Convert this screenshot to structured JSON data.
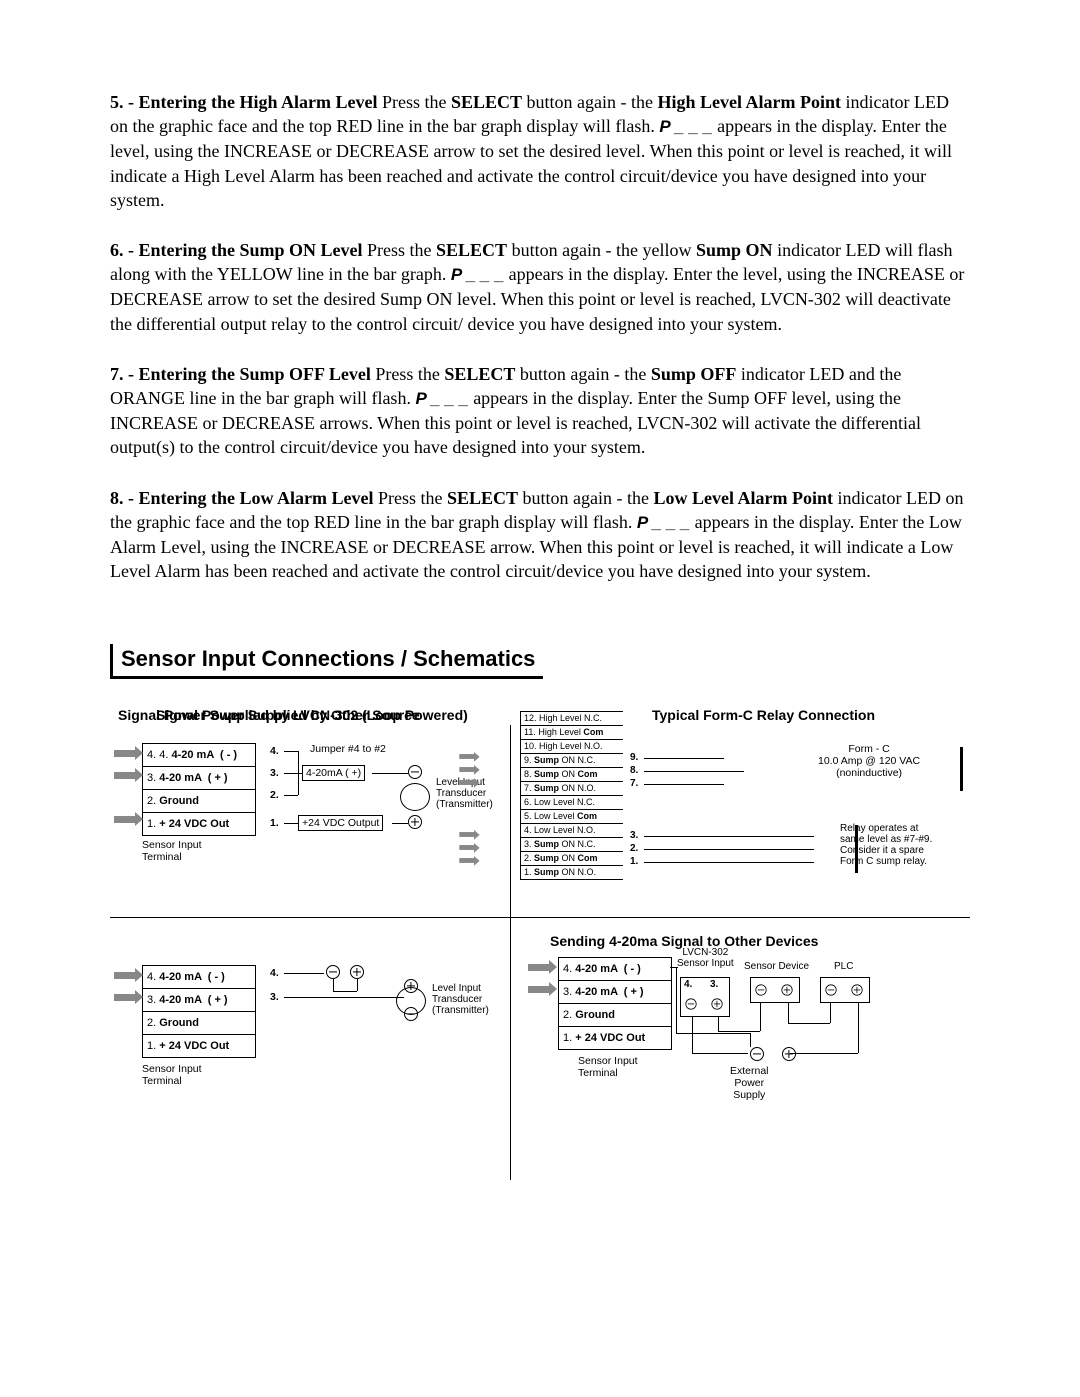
{
  "para5": {
    "lead": "5. - Entering the High Alarm Level",
    "body_a": "   Press the ",
    "select": "SELECT",
    "body_b": " button again - the ",
    "hl": "High Level Alarm Point",
    "body_c": " indicator LED on the graphic face and the top RED line in the bar graph display will flash.  ",
    "pcode": "P _ _ _",
    "body_d": " appears in the display.  Enter the level, using the INCREASE or DECREASE arrow to set the desired level.  When this point or level is reached, it will indicate a High Level Alarm has been reached and activate the control circuit/device you have designed into your system."
  },
  "para6": {
    "lead": "6. - Entering the Sump ON Level",
    "body_a": "   Press the ",
    "select": "SELECT",
    "body_b": " button again -  the yellow ",
    "hl": "Sump ON",
    "body_c": " indicator LED will flash along with the YELLOW  line in the bar graph.  ",
    "pcode": "P _ _ _",
    "body_d": "  appears in the display.  Enter the level, using the INCREASE or DECREASE arrow to set the desired Sump ON level.  When this point or level is reached, LVCN-302 will deactivate the differential output relay to the control circuit/ device you have designed into your system."
  },
  "para7": {
    "lead": "7. - Entering the Sump OFF Level",
    "body_a": "   Press the ",
    "select": "SELECT",
    "body_b": " button again - the ",
    "hl": "Sump OFF",
    "body_c": "  indicator LED and the ORANGE line in the bar graph will flash.  ",
    "pcode": "P _ _ _",
    "body_d": "  appears in the display.   Enter the Sump OFF level, using the INCREASE or DECREASE arrows.  When this point or level is reached, LVCN-302 will activate the differential output(s) to the control circuit/device you have designed into your system."
  },
  "para8": {
    "lead": "8. - Entering the Low Alarm Level",
    "body_a": "   Press the ",
    "select": "SELECT",
    "body_b": " button again - the ",
    "hl": "Low Level Alarm Point",
    "body_c": " indicator LED on the graphic face and the top RED line in the bar graph display will flash.  ",
    "pcode": "P _ _ _",
    "body_d": " appears in the display.  Enter the Low Alarm Level, using the INCREASE or DECREASE arrow.  When this point or level is reached, it will indicate a Low Level Alarm has been reached and  activate the control circuit/device you have designed into your system."
  },
  "section_title": "Sensor Input Connections / Schematics",
  "diag": {
    "q1_title": "Signal Power Supplied by LVCN-302 (Loop Powered)",
    "q2_title": "Typical Form-C Relay Connection",
    "q3_title": "Signal Power Supplied by Other Source",
    "q4_title": "Sending 4-20ma Signal to Other Devices",
    "term_rows": [
      "4. 4-20 mA  ( - )",
      "3. 4-20 mA  ( + )",
      "2. Ground",
      "1. + 24 VDC Out"
    ],
    "sensor_input_terminal": "Sensor Input\nTerminal",
    "jumper": "Jumper #4 to #2",
    "nums": {
      "n1": "1.",
      "n2": "2.",
      "n3": "3.",
      "n4": "4."
    },
    "boxed_420": "4-20mA ( +)",
    "boxed_24v": "+24 VDC Output",
    "level_input": "Level Input\nTransducer\n(Transmitter)",
    "pins": [
      "12. High Level N.C.",
      "11. High Level Com",
      "10. High Level N.O.",
      "9. Sump ON N.C.",
      "8. Sump ON Com",
      "7. Sump ON N.O.",
      "6. Low Level N.C.",
      "5. Low Level Com",
      "4. Low Level N.O.",
      "3. Sump ON N.C.",
      "2. Sump ON Com",
      "1. Sump ON N.O."
    ],
    "pins_bold_idx": [
      "Sump",
      "Com"
    ],
    "formc": "Form - C\n10.0 Amp @ 120 VAC\n(noninductive)",
    "relay_note": "Relay operates at\nsame level as #7-#9.\nConsider it a spare\nForm C sump relay.",
    "lvcn_label": "LVCN-302\nSensor Input",
    "sensor_device": "Sensor Device",
    "plc": "PLC",
    "ext_power": "External\nPower\nSupply"
  }
}
